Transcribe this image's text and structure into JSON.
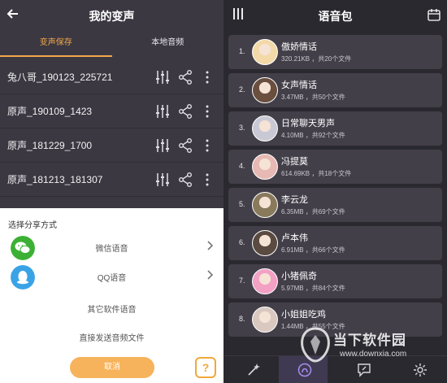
{
  "left": {
    "title": "我的变声",
    "tabs": [
      {
        "label": "变声保存",
        "active": true
      },
      {
        "label": "本地音频",
        "active": false
      }
    ],
    "recordings": [
      {
        "name": "兔八哥_190123_225721"
      },
      {
        "name": "原声_190109_1423"
      },
      {
        "name": "原声_181229_1700"
      },
      {
        "name": "原声_181213_181307"
      }
    ],
    "share_sheet": {
      "title": "选择分享方式",
      "options": [
        {
          "label": "微信语音",
          "icon": "wechat-icon"
        },
        {
          "label": "QQ语音",
          "icon": "qq-icon"
        },
        {
          "label": "其它软件语音"
        },
        {
          "label": "直接发送音频文件"
        }
      ],
      "cancel_label": "取消",
      "help_glyph": "?"
    }
  },
  "right": {
    "title": "语音包",
    "packs": [
      {
        "num": "1.",
        "name": "傲娇情话",
        "info": "320.21KB ，共20个文件",
        "avatar_color": "#f3d9a8"
      },
      {
        "num": "2.",
        "name": "女声情话",
        "info": "3.47MB ，共50个文件",
        "avatar_color": "#6a4e3e"
      },
      {
        "num": "3.",
        "name": "日常聊天男声",
        "info": "4.10MB ，共92个文件",
        "avatar_color": "#c9c9d6"
      },
      {
        "num": "4.",
        "name": "冯提莫",
        "info": "614.69KB ，共18个文件",
        "avatar_color": "#e7b9b4"
      },
      {
        "num": "5.",
        "name": "李云龙",
        "info": "6.35MB ，共69个文件",
        "avatar_color": "#8a7a5c"
      },
      {
        "num": "6.",
        "name": "卢本伟",
        "info": "6.91MB ，共66个文件",
        "avatar_color": "#5a4a40"
      },
      {
        "num": "7.",
        "name": "小猪佩奇",
        "info": "5.97MB ，共84个文件",
        "avatar_color": "#f2a0c4"
      },
      {
        "num": "8.",
        "name": "小姐姐吃鸡",
        "info": "1.44MB ，共55个文件",
        "avatar_color": "#d8c8c0"
      }
    ]
  },
  "watermark": {
    "main": "当下软件园",
    "sub": "www.downxia.com"
  },
  "colors": {
    "accent": "#f4a84a",
    "left_bg": "#3b3842",
    "right_bg": "#2b2930",
    "card_bg": "#423f49",
    "wechat": "#3cb034",
    "qq": "#3aa3e6"
  }
}
